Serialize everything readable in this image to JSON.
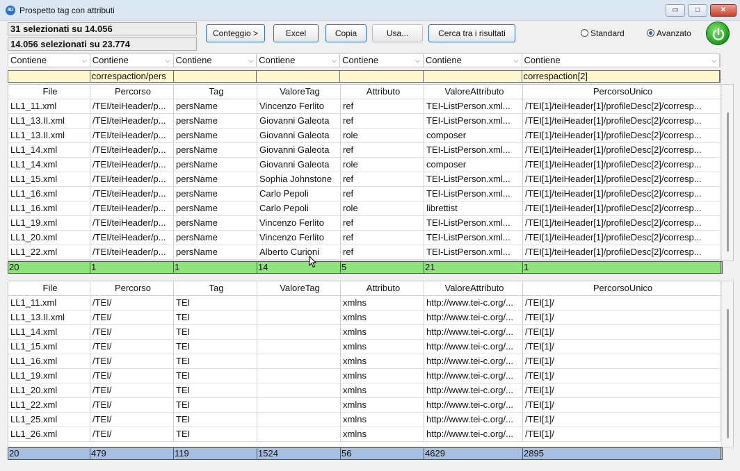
{
  "window": {
    "title": "Prospetto tag con attributi",
    "app_icon_text": "4D",
    "min_glyph": "▭",
    "max_glyph": "□",
    "close_glyph": "✕"
  },
  "status": {
    "line1": "31 selezionati su 14.056",
    "line2": "14.056 selezionati su 23.774"
  },
  "toolbar": {
    "conteggio": "Conteggio >",
    "excel": "Excel",
    "copia": "Copia",
    "usa": "Usa...",
    "cerca": "Cerca tra i risultati"
  },
  "mode": {
    "standard": "Standard",
    "avanzato": "Avanzato",
    "selected": "Avanzato"
  },
  "filters": [
    "Contiene",
    "Contiene",
    "Contiene",
    "Contiene",
    "Contiene",
    "Contiene",
    "Contiene"
  ],
  "search_values": [
    "",
    "correspaction/pers",
    "",
    "",
    "",
    "",
    "correspaction[2]"
  ],
  "columns": [
    "File",
    "Percorso",
    "Tag",
    "ValoreTag",
    "Attributo",
    "ValoreAttributo",
    "PercorsoUnico"
  ],
  "top_rows": [
    [
      "LL1_11.xml",
      "/TEI/teiHeader/p...",
      "persName",
      "Vincenzo Ferlito",
      "ref",
      "TEI-ListPerson.xml...",
      "/TEI[1]/teiHeader[1]/profileDesc[2]/corresp..."
    ],
    [
      "LL1_13.II.xml",
      "/TEI/teiHeader/p...",
      "persName",
      "Giovanni Galeota",
      "ref",
      "TEI-ListPerson.xml...",
      "/TEI[1]/teiHeader[1]/profileDesc[2]/corresp..."
    ],
    [
      "LL1_13.II.xml",
      "/TEI/teiHeader/p...",
      "persName",
      "Giovanni Galeota",
      "role",
      "composer",
      "/TEI[1]/teiHeader[1]/profileDesc[2]/corresp..."
    ],
    [
      "LL1_14.xml",
      "/TEI/teiHeader/p...",
      "persName",
      "Giovanni Galeota",
      "ref",
      "TEI-ListPerson.xml...",
      "/TEI[1]/teiHeader[1]/profileDesc[2]/corresp..."
    ],
    [
      "LL1_14.xml",
      "/TEI/teiHeader/p...",
      "persName",
      "Giovanni Galeota",
      "role",
      "composer",
      "/TEI[1]/teiHeader[1]/profileDesc[2]/corresp..."
    ],
    [
      "LL1_15.xml",
      "/TEI/teiHeader/p...",
      "persName",
      "Sophia Johnstone",
      "ref",
      "TEI-ListPerson.xml...",
      "/TEI[1]/teiHeader[1]/profileDesc[2]/corresp..."
    ],
    [
      "LL1_16.xml",
      "/TEI/teiHeader/p...",
      "persName",
      "Carlo Pepoli",
      "ref",
      "TEI-ListPerson.xml...",
      "/TEI[1]/teiHeader[1]/profileDesc[2]/corresp..."
    ],
    [
      "LL1_16.xml",
      "/TEI/teiHeader/p...",
      "persName",
      "Carlo Pepoli",
      "role",
      "librettist",
      "/TEI[1]/teiHeader[1]/profileDesc[2]/corresp..."
    ],
    [
      "LL1_19.xml",
      "/TEI/teiHeader/p...",
      "persName",
      "Vincenzo Ferlito",
      "ref",
      "TEI-ListPerson.xml...",
      "/TEI[1]/teiHeader[1]/profileDesc[2]/corresp..."
    ],
    [
      "LL1_20.xml",
      "/TEI/teiHeader/p...",
      "persName",
      "Vincenzo Ferlito",
      "ref",
      "TEI-ListPerson.xml...",
      "/TEI[1]/teiHeader[1]/profileDesc[2]/corresp..."
    ],
    [
      "LL1_22.xml",
      "/TEI/teiHeader/p...",
      "persName",
      "Alberto Curioni",
      "ref",
      "TEI-ListPerson.xml...",
      "/TEI[1]/teiHeader[1]/profileDesc[2]/corresp..."
    ]
  ],
  "top_counts": [
    "20",
    "1",
    "1",
    "14",
    "5",
    "21",
    "1"
  ],
  "bottom_rows": [
    [
      "LL1_11.xml",
      "/TEI/",
      "TEI",
      "",
      "xmlns",
      "http://www.tei-c.org/...",
      "/TEI[1]/"
    ],
    [
      "LL1_13.II.xml",
      "/TEI/",
      "TEI",
      "",
      "xmlns",
      "http://www.tei-c.org/...",
      "/TEI[1]/"
    ],
    [
      "LL1_14.xml",
      "/TEI/",
      "TEI",
      "",
      "xmlns",
      "http://www.tei-c.org/...",
      "/TEI[1]/"
    ],
    [
      "LL1_15.xml",
      "/TEI/",
      "TEI",
      "",
      "xmlns",
      "http://www.tei-c.org/...",
      "/TEI[1]/"
    ],
    [
      "LL1_16.xml",
      "/TEI/",
      "TEI",
      "",
      "xmlns",
      "http://www.tei-c.org/...",
      "/TEI[1]/"
    ],
    [
      "LL1_19.xml",
      "/TEI/",
      "TEI",
      "",
      "xmlns",
      "http://www.tei-c.org/...",
      "/TEI[1]/"
    ],
    [
      "LL1_20.xml",
      "/TEI/",
      "TEI",
      "",
      "xmlns",
      "http://www.tei-c.org/...",
      "/TEI[1]/"
    ],
    [
      "LL1_22.xml",
      "/TEI/",
      "TEI",
      "",
      "xmlns",
      "http://www.tei-c.org/...",
      "/TEI[1]/"
    ],
    [
      "LL1_25.xml",
      "/TEI/",
      "TEI",
      "",
      "xmlns",
      "http://www.tei-c.org/...",
      "/TEI[1]/"
    ],
    [
      "LL1_26.xml",
      "/TEI/",
      "TEI",
      "",
      "xmlns",
      "http://www.tei-c.org/...",
      "/TEI[1]/"
    ]
  ],
  "bottom_counts": [
    "20",
    "479",
    "119",
    "1524",
    "56",
    "4629",
    "2895"
  ],
  "colors": {
    "search_bg": "#fff8cf",
    "top_count_bg": "#8ee37a",
    "bottom_count_bg": "#a7bfe0",
    "button_border": "#2c6fbf"
  }
}
